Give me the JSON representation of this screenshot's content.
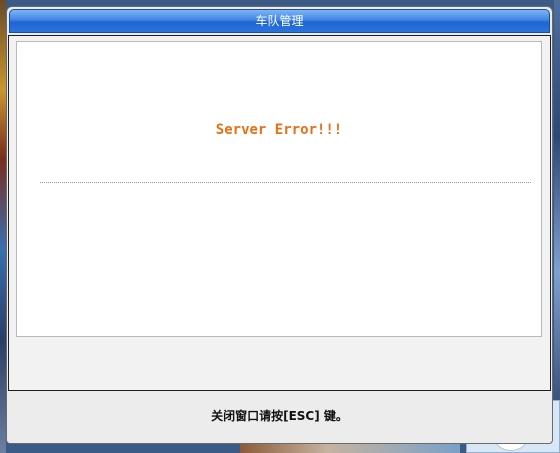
{
  "window": {
    "title": "车队管理"
  },
  "message": {
    "error_text": "Server Error!!!"
  },
  "footer": {
    "hint": "关闭窗口请按[ESC] 键。"
  },
  "colors": {
    "error_text": "#e86f14",
    "titlebar_blue": "#2a74de"
  }
}
